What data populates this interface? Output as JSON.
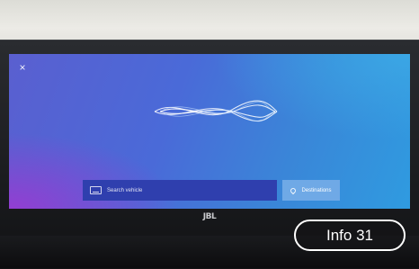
{
  "screen": {
    "close_glyph": "×",
    "search": {
      "placeholder": "Search vehicle",
      "icon": "keyboard-icon"
    },
    "destinations": {
      "label": "Destinations",
      "icon": "location-pin-icon"
    }
  },
  "hardware": {
    "brand": "JBL"
  },
  "overlay": {
    "info_label": "Info 31"
  },
  "colors": {
    "screen_gradient_left": "#7a3fd0",
    "screen_gradient_right": "#2f9be0",
    "search_bar": "#2f3fae",
    "destinations_button": "#6fa9e6"
  }
}
